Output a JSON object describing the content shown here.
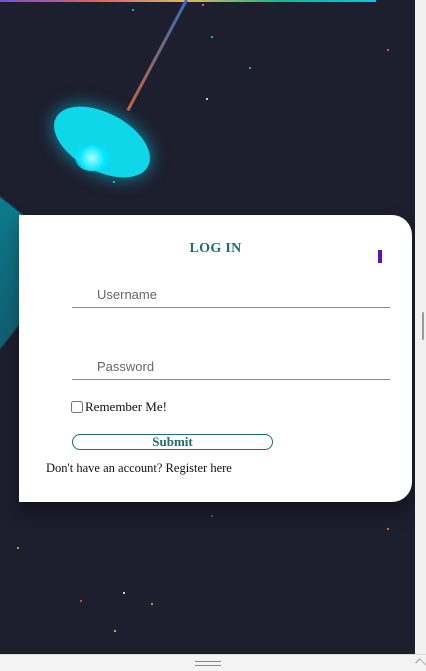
{
  "login": {
    "title": "LOG IN",
    "username_placeholder": "Username",
    "password_placeholder": "Password",
    "remember_label": "Remember Me!",
    "submit_label": "Submit",
    "register_text": "Don't have an account? Register here"
  },
  "colors": {
    "background": "#1d1e2e",
    "accent_teal": "#1e6b74",
    "lamp_cyan": "#0fd7ea",
    "marker_purple": "#6a0dad"
  }
}
